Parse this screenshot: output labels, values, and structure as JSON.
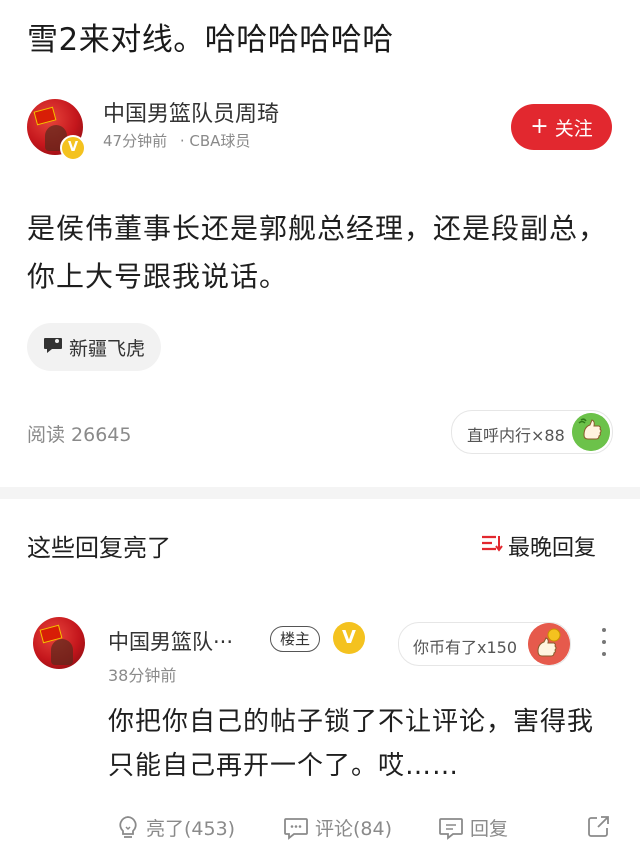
{
  "post": {
    "title": "雪2来对线。哈哈哈哈哈哈",
    "author": {
      "name": "中国男篮队员周琦",
      "verified_mark": "V",
      "time": "47分钟前",
      "role": "· CBA球员"
    },
    "follow_label": "关注",
    "follow_plus": "+",
    "content": "是侯伟董事长还是郭舰总经理，还是段副总，你上大号跟我说话。",
    "tag": "新疆飞虎",
    "reads": "阅读 26645",
    "reward": "直呼内行×88"
  },
  "replies_section": {
    "title": "这些回复亮了",
    "sort_label": "最晚回复"
  },
  "comment": {
    "author": "中国男篮队···",
    "op_badge": "楼主",
    "verified_mark": "V",
    "coin_text": "你币有了x150",
    "time": "38分钟前",
    "text": "你把你自己的帖子锁了不让评论，害得我只能自己再开一个了。哎……"
  },
  "actions": {
    "like": "亮了(453)",
    "comment": "评论(84)",
    "reply": "回复"
  },
  "colors": {
    "accent": "#e2282f",
    "verify": "#f4c21f",
    "muted": "#8a8a8a"
  },
  "icons": [
    "verified-icon",
    "chat-bubble-icon",
    "sort-icon",
    "thumbs-emoji-icon",
    "coin-emoji-icon",
    "more-icon",
    "lightbulb-icon",
    "comment-icon",
    "reply-icon",
    "share-icon"
  ]
}
